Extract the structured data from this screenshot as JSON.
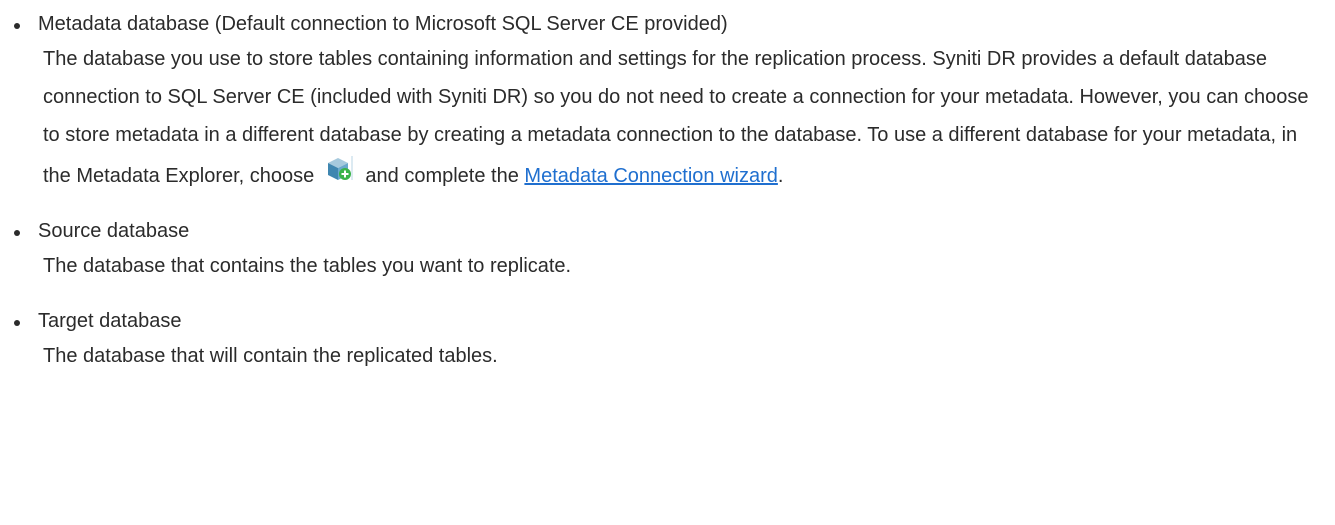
{
  "items": [
    {
      "title": "Metadata database (Default connection to Microsoft SQL Server CE provided)",
      "description_before": "The database you use to store tables containing information and settings for the replication process. Syniti DR provides a default database connection to SQL Server CE (included with Syniti DR) so you do not need to create a connection for your metadata. However, you can choose to store metadata in a different database by creating a metadata connection to the database. To use a different database for your metadata, in the Metadata Explorer, choose",
      "description_middle": "and complete the",
      "link_text": "Metadata Connection wizard",
      "description_after": ".",
      "icon": "add-connection-icon"
    },
    {
      "title": "Source database",
      "description": "The database that contains the tables you want to replicate."
    },
    {
      "title": "Target database",
      "description": "The database that will contain the replicated tables."
    }
  ],
  "colors": {
    "text": "#2b2b2b",
    "link": "#1f6fcf"
  }
}
